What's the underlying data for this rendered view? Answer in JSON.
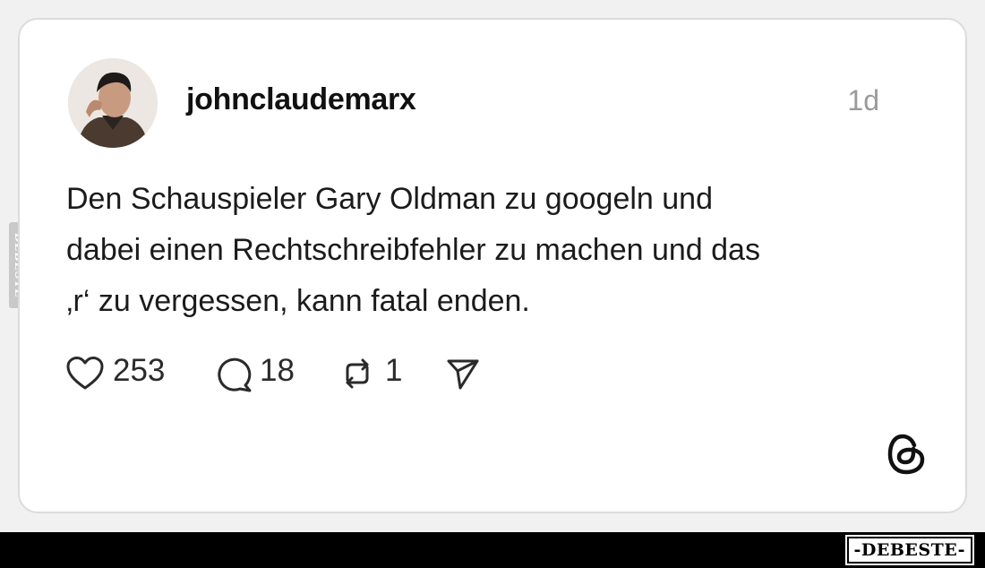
{
  "post": {
    "username": "johnclaudemarx",
    "time": "1d",
    "text_lines": [
      "Den Schauspieler Gary Oldman zu googeln und",
      "dabei einen Rechtschreibfehler zu machen und das",
      "‚r‘ zu vergessen, kann fatal enden."
    ],
    "likes": "253",
    "replies": "18",
    "reposts": "1"
  },
  "watermark": {
    "side_text": "DEBESTE",
    "brand_text": "-DEBESTE-"
  },
  "colors": {
    "card_background": "#ffffff",
    "page_background": "#f1f1f1",
    "text": "#1b1b1b",
    "muted": "#9a9a9a"
  }
}
